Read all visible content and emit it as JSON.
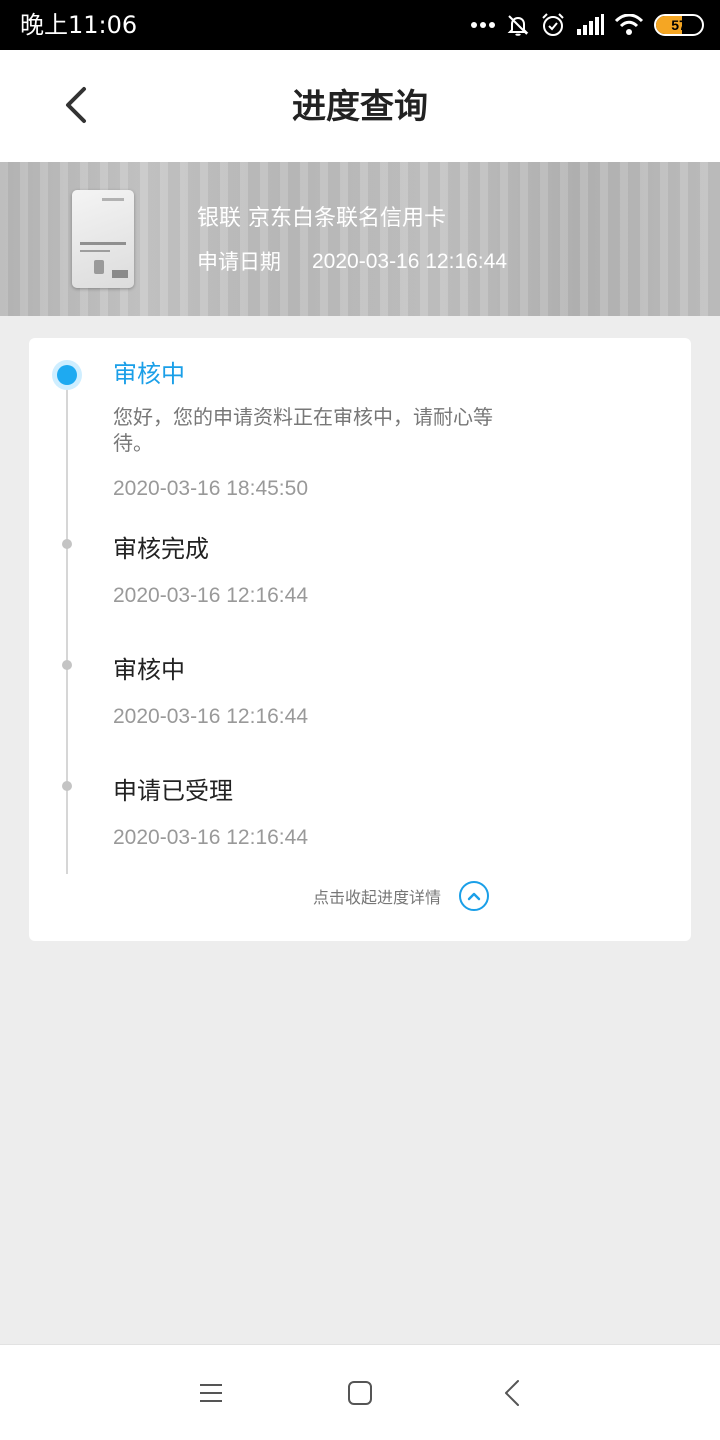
{
  "status_bar": {
    "time": "晚上11:06",
    "battery_level": "57",
    "battery_fraction": 0.57,
    "icons": [
      "more-dots-icon",
      "bell-muted-icon",
      "alarm-icon",
      "signal-icon",
      "wifi-icon",
      "battery-icon"
    ]
  },
  "header": {
    "title": "进度查询",
    "back_icon": "chevron-left-icon"
  },
  "card": {
    "name": "银联 京东白条联名信用卡",
    "date_label": "申请日期",
    "date_value": "2020-03-16 12:16:44"
  },
  "progress": {
    "current": {
      "title": "审核中",
      "description": "您好，您的申请资料正在审核中，请耐心等待。",
      "time": "2020-03-16 18:45:50"
    },
    "history": [
      {
        "title": "审核完成",
        "time": "2020-03-16 12:16:44"
      },
      {
        "title": "审核中",
        "time": "2020-03-16 12:16:44"
      },
      {
        "title": "申请已受理",
        "time": "2020-03-16 12:16:44"
      }
    ],
    "collapse_label": "点击收起进度详情",
    "collapse_icon": "chevron-up-circle-icon"
  },
  "colors": {
    "accent": "#1A9FE8",
    "battery": "#F5A623",
    "background": "#EDEDED"
  },
  "system_nav": {
    "icons": [
      "menu-icon",
      "home-icon",
      "back-icon"
    ]
  }
}
